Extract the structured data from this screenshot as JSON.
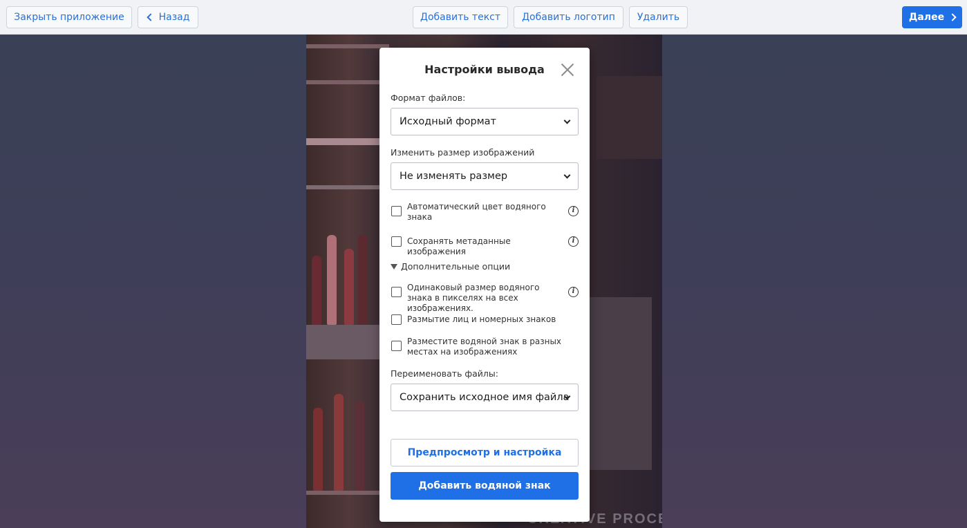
{
  "toolbar": {
    "close_app": "Закрыть приложение",
    "back": "Назад",
    "add_text": "Добавить текст",
    "add_logo": "Добавить логотип",
    "delete": "Удалить",
    "next": "Далее",
    "accent_color": "#1f6fe6"
  },
  "photo": {
    "watermark_text": "CREATIVE PROCESS"
  },
  "modal": {
    "title": "Настройки вывода",
    "close_icon": "close-icon",
    "file_format_label": "Формат файлов:",
    "file_format_value": "Исходный формат",
    "resize_label": "Изменить размер изображений",
    "resize_value": "Не изменять размер",
    "auto_color_label": "Автоматический цвет водяного знака",
    "keep_metadata_label": "Сохранять метаданные изображения",
    "advanced_label": "Дополнительные опции",
    "same_size_label": "Одинаковый размер водяного знака в пикселях на всех изображениях.",
    "blur_label": "Размытие лиц и номерных знаков",
    "random_place_label": "Разместите водяной знак в разных местах на изображениях",
    "rename_label": "Переименовать файлы:",
    "rename_value": "Сохранить исходное имя файла",
    "preview_button": "Предпросмотр и настройка",
    "add_watermark_button": "Добавить водяной знак",
    "info_icon": "info-icon"
  }
}
